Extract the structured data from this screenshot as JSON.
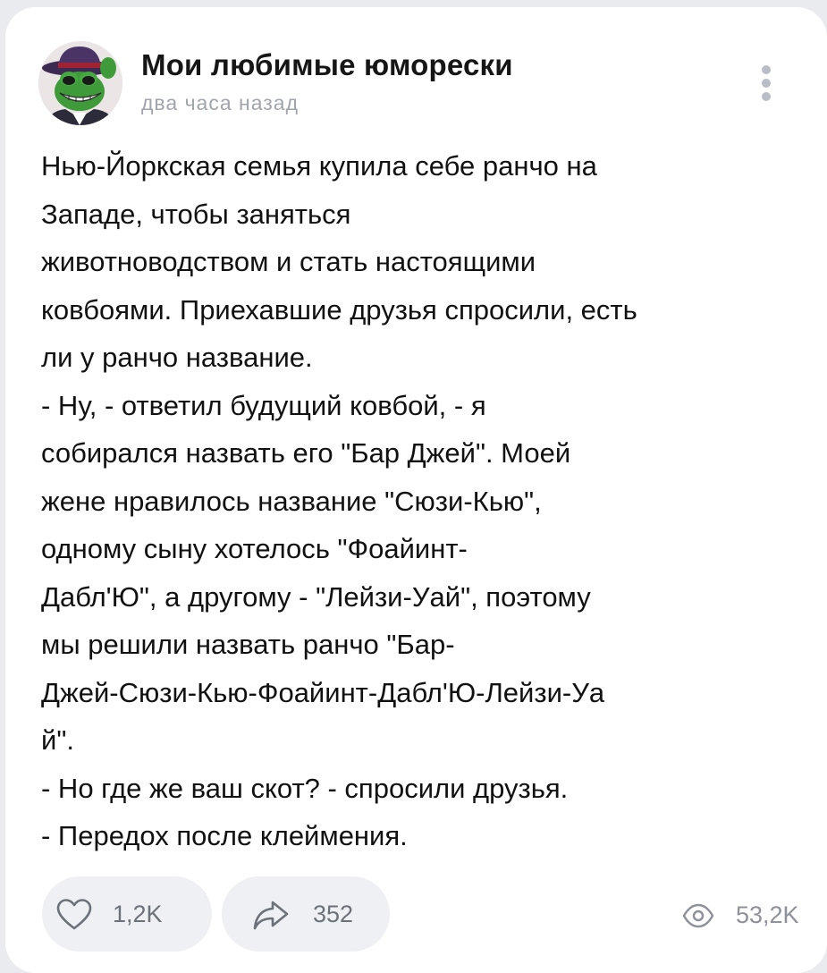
{
  "post": {
    "author": "Мои любимые юморески",
    "time": "два часа назад",
    "lines": [
      "Нью-Йоркская семья купила себе ранчо на",
      "Западе, чтобы заняться",
      "животноводством и стать настоящими",
      "ковбоями. Приехавшие друзья спросили, есть",
      "ли у ранчо название.",
      "- Ну, - ответил будущий ковбой, - я",
      "собирался назвать его \"Бар Джей\". Моей",
      "жене нравилось название \"Сюзи-Кью\",",
      "одному сыну хотелось \"Фоайинт-",
      "Дабл'Ю\", а другому - \"Лейзи-Уай\", поэтому",
      "мы решили назвать ранчо \"Бар-",
      "Джей-Сюзи-Кью-Фоайинт-Дабл'Ю-Лейзи-Уа",
      "й\".",
      "- Но где же ваш скот? - спросили друзья.",
      "- Передох после клеймения."
    ]
  },
  "actions": {
    "likes": "1,2K",
    "shares": "352",
    "views": "53,2K"
  },
  "icons": {
    "avatar": "green-frog-gangster-avatar",
    "menu": "vertical-dots-icon",
    "like": "heart-outline-icon",
    "share": "share-arrow-icon",
    "views": "eye-icon"
  },
  "colors": {
    "background": "#e9ebef",
    "card": "#ffffff",
    "pill": "#eef0f3",
    "muted": "#a1a5ad"
  }
}
